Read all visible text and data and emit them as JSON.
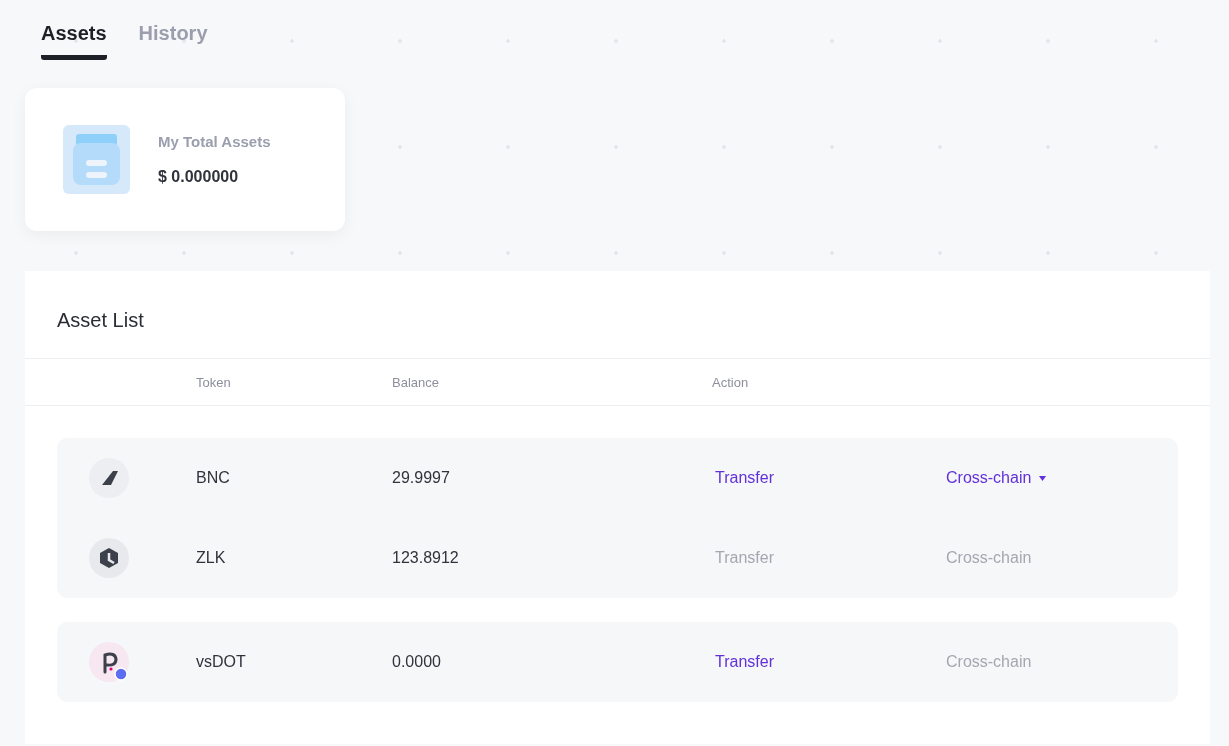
{
  "tabs": [
    {
      "label": "Assets",
      "selected": true
    },
    {
      "label": "History",
      "selected": false
    }
  ],
  "summary": {
    "label": "My Total Assets",
    "value": "$ 0.000000"
  },
  "asset_list": {
    "title": "Asset List",
    "columns": [
      "Token",
      "Balance",
      "Action"
    ],
    "groups": [
      {
        "rows": [
          {
            "kind": "bnc",
            "token": "BNC",
            "balance": "29.9997",
            "transfer": {
              "label": "Transfer",
              "disabled": false
            },
            "cross_chain": {
              "label": "Cross-chain",
              "disabled": false,
              "dropdown": true
            }
          },
          {
            "kind": "zlk",
            "token": "ZLK",
            "balance": "123.8912",
            "transfer": {
              "label": "Transfer",
              "disabled": true
            },
            "cross_chain": {
              "label": "Cross-chain",
              "disabled": true,
              "dropdown": false
            }
          }
        ]
      },
      {
        "rows": [
          {
            "kind": "vsdot",
            "token": "vsDOT",
            "balance": "0.0000",
            "transfer": {
              "label": "Transfer",
              "disabled": false
            },
            "cross_chain": {
              "label": "Cross-chain",
              "disabled": true,
              "dropdown": false
            }
          }
        ]
      }
    ]
  }
}
